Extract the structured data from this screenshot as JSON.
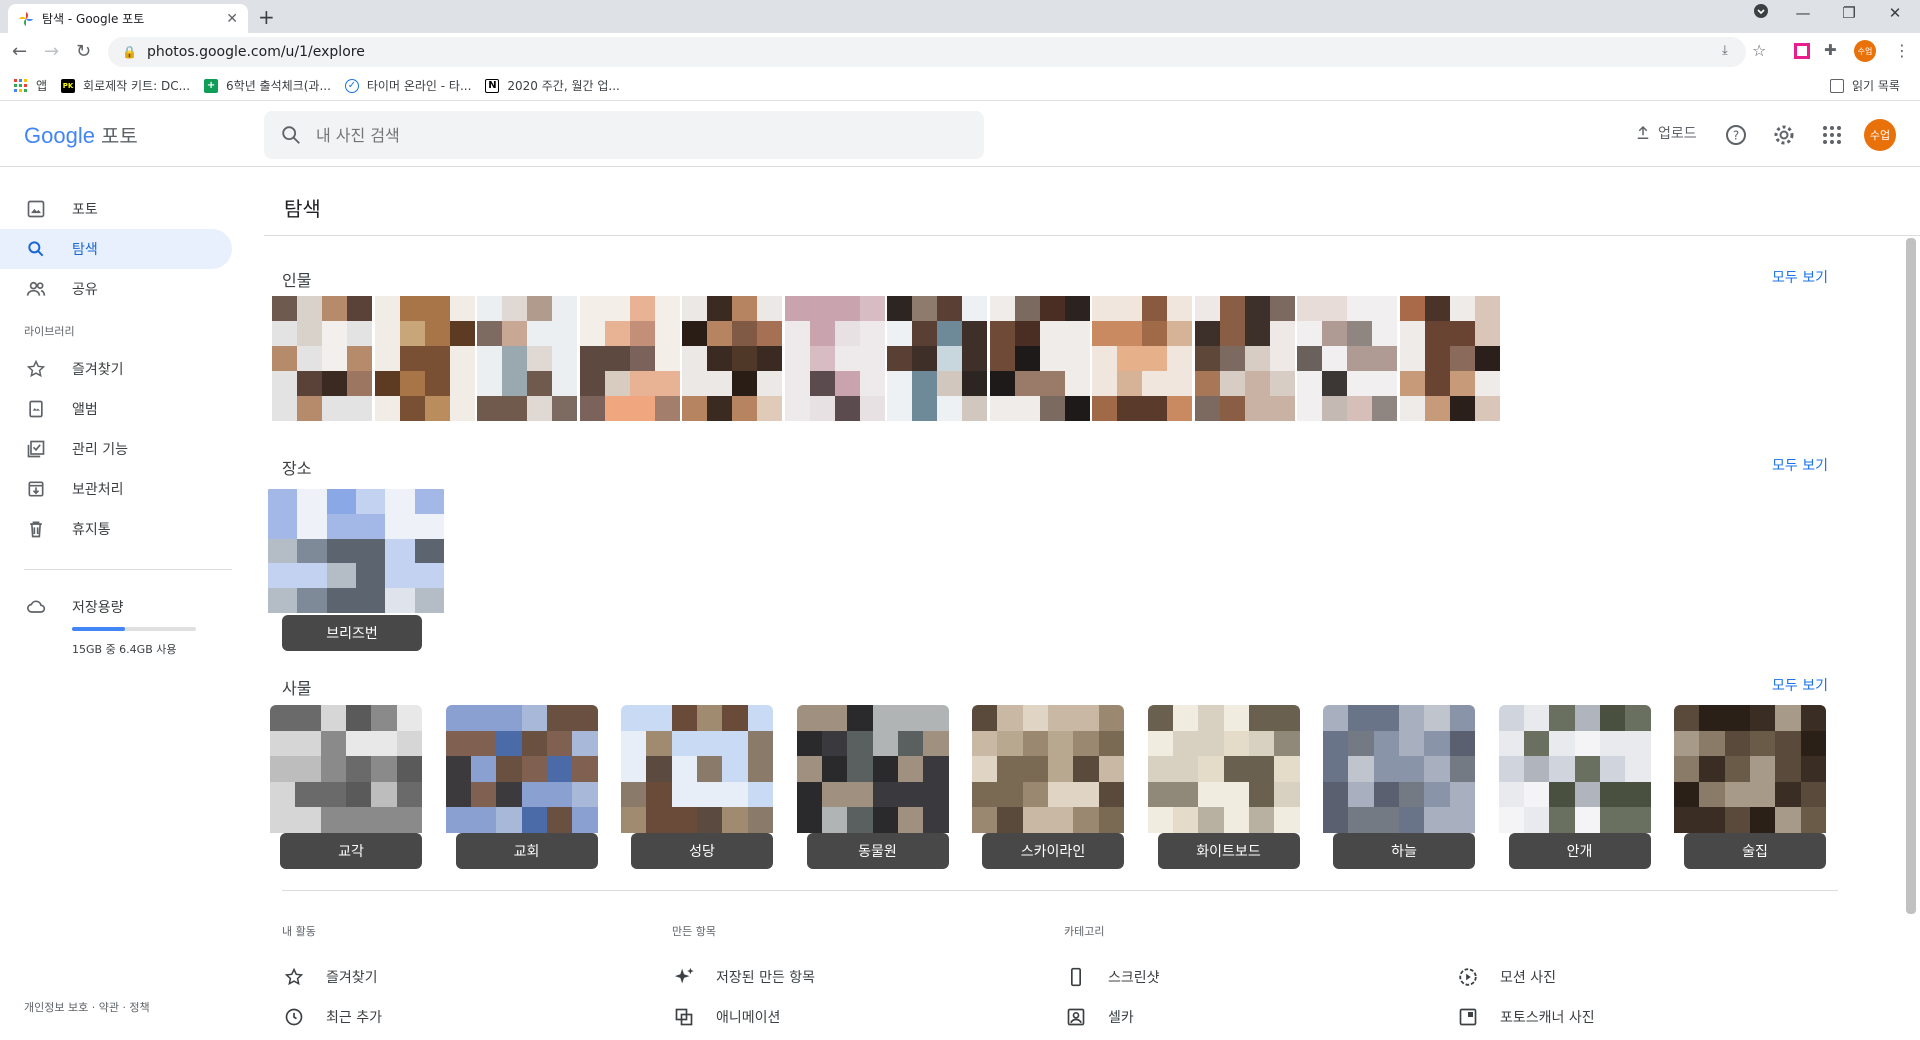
{
  "browser": {
    "tab_title": "탐색 - Google 포토",
    "url": "photos.google.com/u/1/explore",
    "bookmarks": [
      {
        "label": "앱"
      },
      {
        "label": "회로제작 키트: DC..."
      },
      {
        "label": "6학년 출석체크(과..."
      },
      {
        "label": "타이머 온라인 - 타..."
      },
      {
        "label": "2020 주간, 월간 업..."
      }
    ],
    "reading_list": "읽기 목록",
    "profile_initials": "수업"
  },
  "header": {
    "logo_google": "Google",
    "logo_product": "포토",
    "search_placeholder": "내 사진 검색",
    "upload_label": "업로드",
    "avatar_initials": "수업"
  },
  "sidebar": {
    "items": [
      {
        "label": "포토",
        "icon": "photo-icon"
      },
      {
        "label": "탐색",
        "icon": "search-icon",
        "active": true
      },
      {
        "label": "공유",
        "icon": "people-icon"
      }
    ],
    "library_header": "라이브러리",
    "library_items": [
      {
        "label": "즐겨찾기",
        "icon": "star-icon"
      },
      {
        "label": "앨범",
        "icon": "album-icon"
      },
      {
        "label": "관리 기능",
        "icon": "checklist-icon"
      },
      {
        "label": "보관처리",
        "icon": "archive-icon"
      },
      {
        "label": "휴지통",
        "icon": "trash-icon"
      }
    ],
    "storage_label": "저장용량",
    "storage_used": "15GB 중 6.4GB 사용",
    "storage_fraction": 0.43,
    "footer": "개인정보 보호 · 약관 · 정책"
  },
  "main": {
    "page_title": "탐색",
    "see_all": "모두 보기",
    "people_title": "인물",
    "places_title": "장소",
    "places": [
      {
        "label": "브리즈번"
      }
    ],
    "things_title": "사물",
    "things": [
      {
        "label": "교각"
      },
      {
        "label": "교회"
      },
      {
        "label": "성당"
      },
      {
        "label": "동물원"
      },
      {
        "label": "스카이라인"
      },
      {
        "label": "화이트보드"
      },
      {
        "label": "하늘"
      },
      {
        "label": "안개"
      },
      {
        "label": "술집"
      }
    ],
    "activity_header": "내 활동",
    "creations_header": "만든 항목",
    "category_header": "카테고리",
    "links": [
      {
        "label": "즐겨찾기",
        "icon": "star-icon"
      },
      {
        "label": "저장된 만든 항목",
        "icon": "sparkle-icon"
      },
      {
        "label": "스크린샷",
        "icon": "phone-icon"
      },
      {
        "label": "모션 사진",
        "icon": "motion-icon"
      },
      {
        "label": "최근 추가",
        "icon": "clock-icon"
      },
      {
        "label": "애니메이션",
        "icon": "animation-icon"
      },
      {
        "label": "셀카",
        "icon": "selfie-icon"
      },
      {
        "label": "포토스캐너 사진",
        "icon": "photoscan-icon"
      }
    ]
  },
  "colors": {
    "accent_blue": "#1a73e8",
    "active_bg": "#e8f0fe",
    "avatar_orange": "#e8710a"
  }
}
